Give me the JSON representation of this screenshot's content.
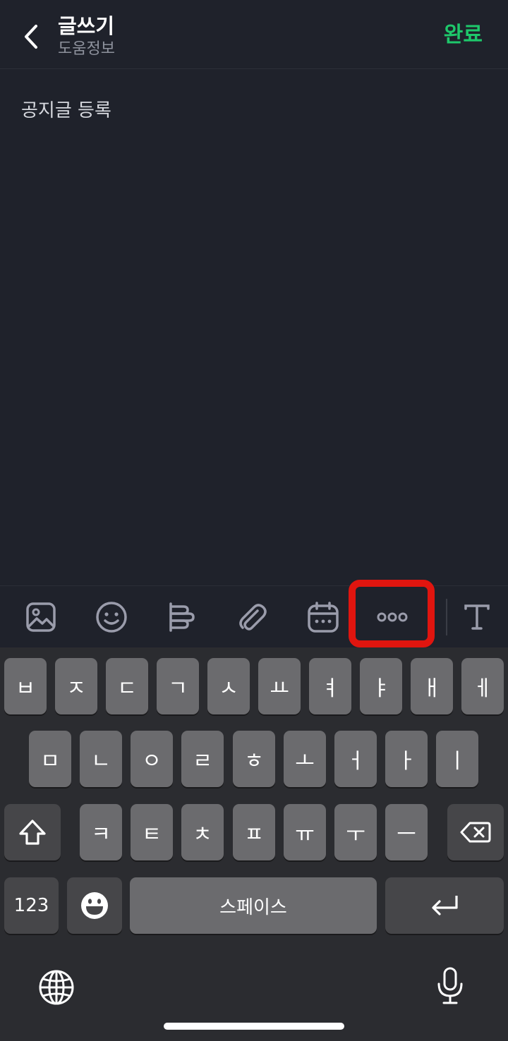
{
  "header": {
    "title": "글쓰기",
    "subtitle": "도움정보",
    "done_label": "완료",
    "back_icon": "chevron-left-icon"
  },
  "editor": {
    "placeholder": "공지글 등록"
  },
  "toolbar": {
    "tools": [
      "image-icon",
      "emoji-icon",
      "align-icon",
      "attachment-icon",
      "calendar-icon",
      "more-icon",
      "text-format-icon"
    ],
    "highlighted_tool": "more-icon",
    "highlight_color": "#e0150f"
  },
  "keyboard": {
    "row1": [
      "ㅂ",
      "ㅈ",
      "ㄷ",
      "ㄱ",
      "ㅅ",
      "ㅛ",
      "ㅕ",
      "ㅑ",
      "ㅐ",
      "ㅔ"
    ],
    "row2": [
      "ㅁ",
      "ㄴ",
      "ㅇ",
      "ㄹ",
      "ㅎ",
      "ㅗ",
      "ㅓ",
      "ㅏ",
      "ㅣ"
    ],
    "row3": [
      "ㅋ",
      "ㅌ",
      "ㅊ",
      "ㅍ",
      "ㅠ",
      "ㅜ",
      "ㅡ"
    ],
    "numbers_label": "123",
    "space_label": "스페이스",
    "shift_icon": "shift-icon",
    "backspace_icon": "backspace-icon",
    "emoji_icon": "emoji-keyboard-icon",
    "return_icon": "return-icon",
    "globe_icon": "globe-icon",
    "mic_icon": "microphone-icon"
  },
  "colors": {
    "background": "#1f222b",
    "accent": "#1ec86b",
    "key": "#6b6b6e",
    "key_dark": "#464649"
  }
}
